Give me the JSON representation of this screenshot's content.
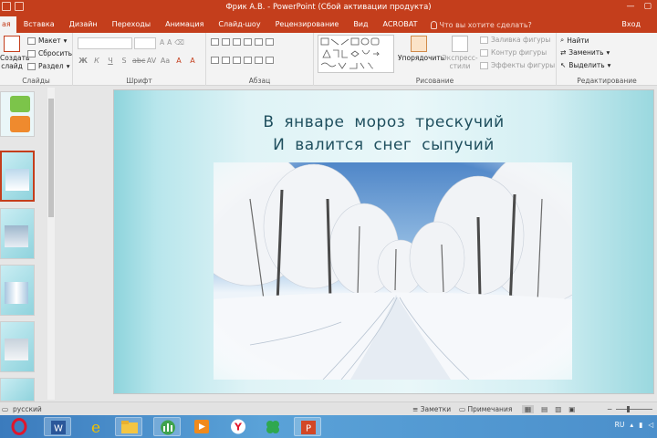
{
  "window": {
    "title": "Фрик А.В. - PowerPoint (Сбой активации продукта)",
    "login": "Вход"
  },
  "tabs": [
    "Главная",
    "Вставка",
    "Дизайн",
    "Переходы",
    "Анимация",
    "Слайд-шоу",
    "Рецензирование",
    "Вид",
    "ACROBAT"
  ],
  "tab_partial": "ая",
  "tell_me": "Что вы хотите сделать?",
  "ribbon": {
    "slides": {
      "label": "Слайды",
      "create_line1": "Создать",
      "create_line2": "слайд",
      "layout": "Макет",
      "reset": "Сбросить",
      "section": "Раздел"
    },
    "font": {
      "label": "Шрифт",
      "buttons": [
        "Ж",
        "К",
        "Ч",
        "S",
        "abc",
        "AV",
        "Aa",
        "A",
        "A"
      ]
    },
    "paragraph": {
      "label": "Абзац"
    },
    "drawing": {
      "label": "Рисование",
      "arrange": "Упорядочить",
      "styles_line1": "Экспресс-",
      "styles_line2": "стили",
      "fill": "Заливка фигуры",
      "outline": "Контур фигуры",
      "effects": "Эффекты фигуры"
    },
    "editing": {
      "label": "Редактирование",
      "find": "Найти",
      "replace": "Заменить",
      "select": "Выделить"
    }
  },
  "slide": {
    "line1": "В январе мороз трескучий",
    "line2": "И валится снег сыпучий"
  },
  "statusbar": {
    "language": "русский",
    "notes": "Заметки",
    "comments": "Примечания"
  },
  "tray": {
    "lang": "RU"
  },
  "colors": {
    "accent": "#c43e1c",
    "taskbar": "#4b8fcb",
    "slide_title": "#1f4f5e"
  },
  "icons": [
    "opera-icon",
    "word-icon",
    "internet-explorer-icon",
    "file-explorer-icon",
    "chart-app-icon",
    "media-player-icon",
    "yandex-browser-icon",
    "clover-app-icon",
    "powerpoint-icon"
  ]
}
